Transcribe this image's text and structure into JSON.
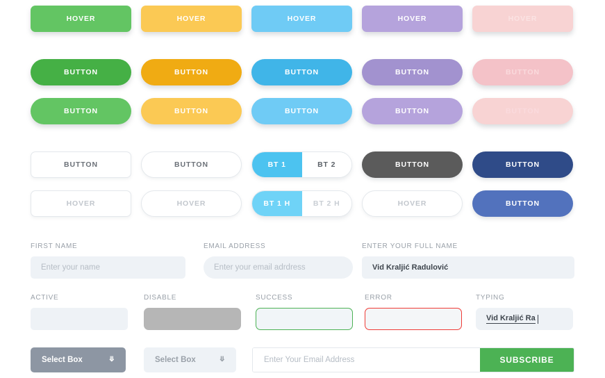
{
  "palette": {
    "green": "#63c563",
    "green_dark": "#45b045",
    "amber": "#fbc954",
    "amber_dark": "#f0ab13",
    "blue": "#6fcbf5",
    "blue_dark": "#40b5e8",
    "purple": "#b5a3dc",
    "purple_dark": "#a292cf",
    "pink": "#f8d3d3",
    "pink_dark": "#f4c2c8",
    "dark_grey": "#5b5b5b",
    "navy": "#2f4b88",
    "navy_hover": "#5272bd",
    "toggle_blue": "#4cc3f0",
    "success_green": "#4cb254",
    "error_red": "#ef3b36",
    "select_grey": "#8d96a3",
    "disabled_grey": "#b6b6b6",
    "subscribe_green": "#4cb254"
  },
  "hover_row": {
    "items": [
      {
        "label": "HOVER",
        "color": "green"
      },
      {
        "label": "HOVER",
        "color": "amber"
      },
      {
        "label": "HOVER",
        "color": "blue"
      },
      {
        "label": "HOVER",
        "color": "purple"
      },
      {
        "label": "HOVER",
        "color": "pink"
      }
    ]
  },
  "pill_row_primary": {
    "items": [
      {
        "label": "BUTTON",
        "color": "green_dark"
      },
      {
        "label": "BUTTON",
        "color": "amber_dark"
      },
      {
        "label": "BUTTON",
        "color": "blue_dark"
      },
      {
        "label": "BUTTON",
        "color": "purple_dark"
      },
      {
        "label": "BUTTON",
        "color": "pink_dark"
      }
    ]
  },
  "pill_row_hover": {
    "items": [
      {
        "label": "BUTTON",
        "color": "green"
      },
      {
        "label": "BUTTON",
        "color": "amber"
      },
      {
        "label": "BUTTON",
        "color": "blue"
      },
      {
        "label": "BUTTON",
        "color": "purple"
      },
      {
        "label": "BUTTON",
        "color": "pink"
      }
    ]
  },
  "outline_row": {
    "button_square": "BUTTON",
    "button_pill": "BUTTON",
    "toggle": {
      "left": "BT 1",
      "right": "BT 2"
    },
    "dark_button": "BUTTON",
    "navy_button": "BUTTON"
  },
  "outline_row_hover": {
    "button_square": "HOVER",
    "button_pill": "HOVER",
    "toggle": {
      "left": "BT 1 H",
      "right": "BT 2 H"
    },
    "dark_button": "HOVER",
    "navy_button": "BUTTON"
  },
  "form": {
    "first_name": {
      "label": "FIRST NAME",
      "placeholder": "Enter your name",
      "value": ""
    },
    "email_address": {
      "label": "EMAIL ADDRESS",
      "placeholder": "Enter your email adrdress",
      "value": ""
    },
    "full_name": {
      "label": "ENTER YOUR FULL NAME",
      "placeholder": "",
      "value": "Vid Kraljić Radulović"
    },
    "active": {
      "label": "ACTIVE",
      "value": ""
    },
    "disable": {
      "label": "DISABLE",
      "value": ""
    },
    "success": {
      "label": "SUCCESS",
      "value": ""
    },
    "error": {
      "label": "ERROR",
      "value": ""
    },
    "typing": {
      "label": "TYPING",
      "value": "Vid Kraljić Ra"
    }
  },
  "selects": {
    "dark": {
      "label": "Select Box",
      "icon": "chevron-down-icon"
    },
    "light": {
      "label": "Select Box",
      "icon": "chevron-down-icon"
    }
  },
  "subscribe": {
    "placeholder": "Enter Your Email Address",
    "button_label": "SUBSCRIBE"
  }
}
